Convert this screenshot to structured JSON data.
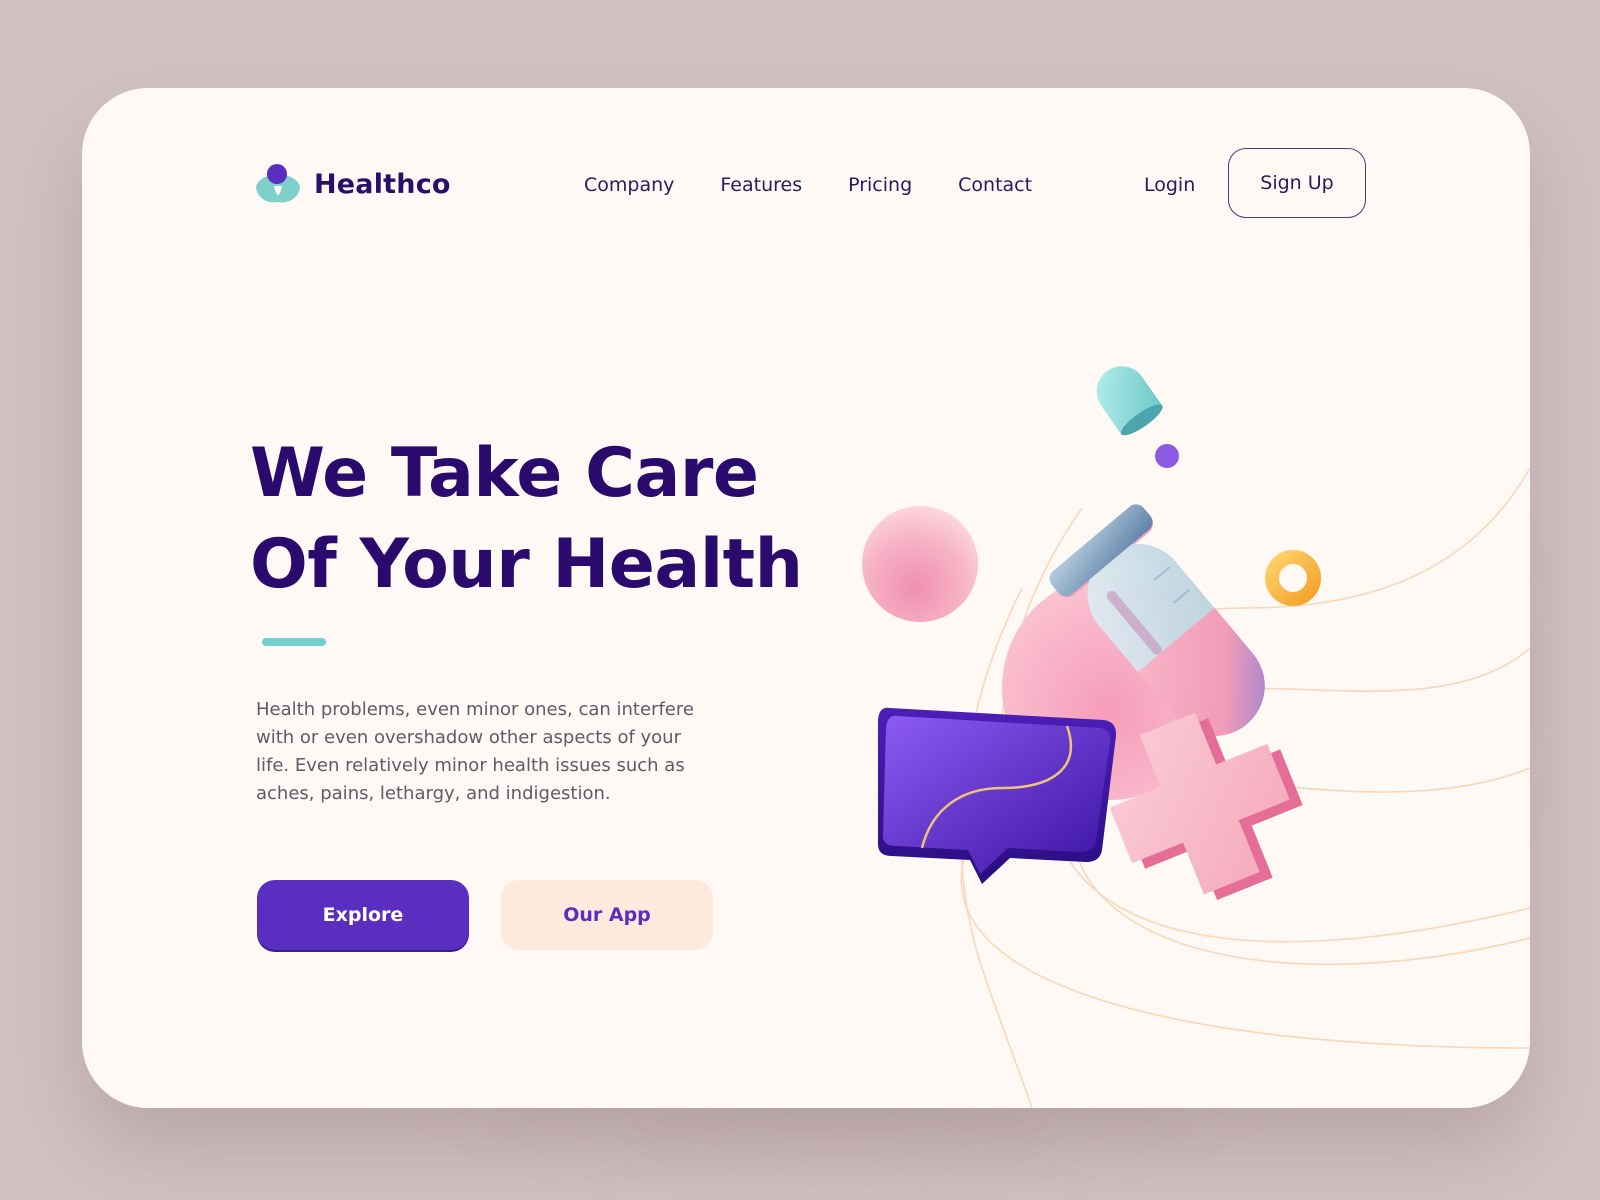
{
  "brand": {
    "name": "Healthco",
    "colors": {
      "primary": "#5a2ebf",
      "navy": "#2b0a6e",
      "teal": "#72cfc9",
      "peach": "#fdeadd",
      "pink": "#f4a6bd",
      "yellow": "#f6b73c"
    }
  },
  "nav": {
    "links": [
      {
        "label": "Company"
      },
      {
        "label": "Features"
      },
      {
        "label": "Pricing"
      },
      {
        "label": "Contact"
      }
    ],
    "login_label": "Login",
    "signup_label": "Sign Up"
  },
  "hero": {
    "title_line1": "We Take Care",
    "title_line2": "Of Your Health",
    "description": "Health problems, even minor ones, can interfere with or even overshadow other aspects of your life. Even relatively minor health issues such as aches, pains, lethargy, and indigestion.",
    "primary_cta": "Explore",
    "secondary_cta": "Our App"
  },
  "illustration": {
    "icons": [
      "test-tube-icon",
      "chat-bubble-icon",
      "plus-cross-icon",
      "pink-sphere-icon",
      "ring-icon",
      "capsule-cap-icon"
    ]
  }
}
